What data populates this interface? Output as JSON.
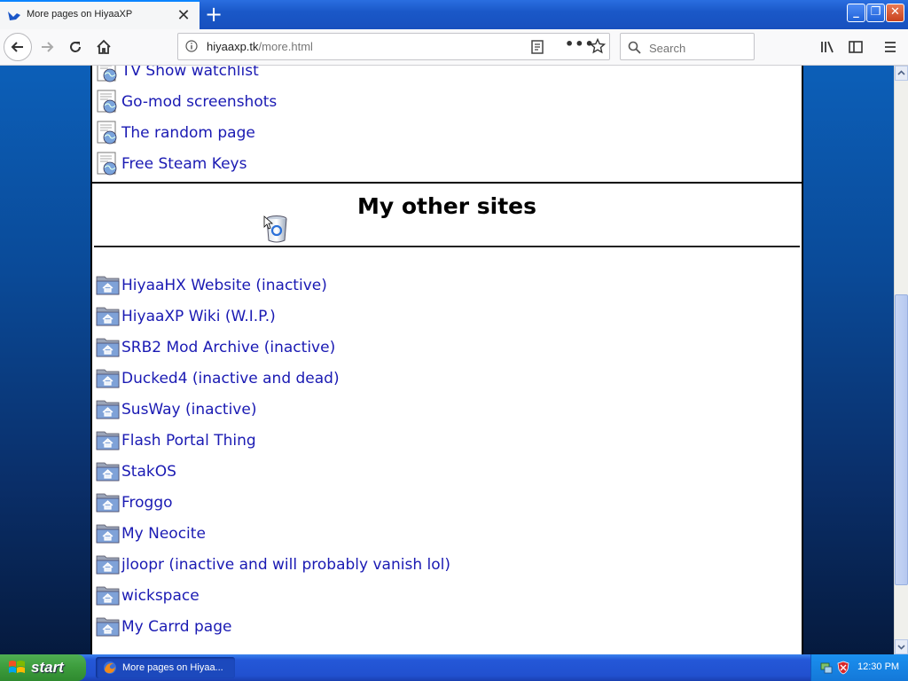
{
  "browser": {
    "tab_title": "More pages on HiyaaXP",
    "url_host": "hiyaaxp.tk",
    "url_path": "/more.html",
    "search_placeholder": "Search"
  },
  "page": {
    "top_links": [
      {
        "label": "TV Show watchlist",
        "icon": "web-page-icon"
      },
      {
        "label": "Go-mod screenshots",
        "icon": "web-page-icon"
      },
      {
        "label": "The random page",
        "icon": "web-page-icon"
      },
      {
        "label": "Free Steam Keys",
        "icon": "web-page-icon"
      }
    ],
    "section_heading": "My other sites",
    "other_sites": [
      {
        "label": "HiyaaHX Website (inactive)",
        "icon": "folder-home-icon"
      },
      {
        "label": "HiyaaXP Wiki (W.I.P.)",
        "icon": "folder-home-icon"
      },
      {
        "label": "SRB2 Mod Archive (inactive)",
        "icon": "folder-home-icon"
      },
      {
        "label": "Ducked4 (inactive and dead)",
        "icon": "folder-home-icon"
      },
      {
        "label": "SusWay (inactive)",
        "icon": "folder-home-icon"
      },
      {
        "label": "Flash Portal Thing",
        "icon": "folder-home-icon"
      },
      {
        "label": "StakOS",
        "icon": "folder-home-icon"
      },
      {
        "label": "Froggo",
        "icon": "folder-home-icon"
      },
      {
        "label": "My Neocite",
        "icon": "folder-home-icon"
      },
      {
        "label": "jloopr (inactive and will probably vanish lol)",
        "icon": "folder-home-icon"
      },
      {
        "label": "wickspace",
        "icon": "folder-home-icon"
      },
      {
        "label": "My Carrd page",
        "icon": "folder-home-icon"
      }
    ]
  },
  "taskbar": {
    "start_label": "start",
    "task_label": "More pages on Hiyaa...",
    "clock": "12:30 PM"
  },
  "colors": {
    "link": "#1a1ab3",
    "desktop_gradient_top": "#0c5fb8",
    "desktop_gradient_bottom": "#051a3e",
    "taskbar_blue": "#2458d8",
    "start_green": "#3c9c3c"
  }
}
